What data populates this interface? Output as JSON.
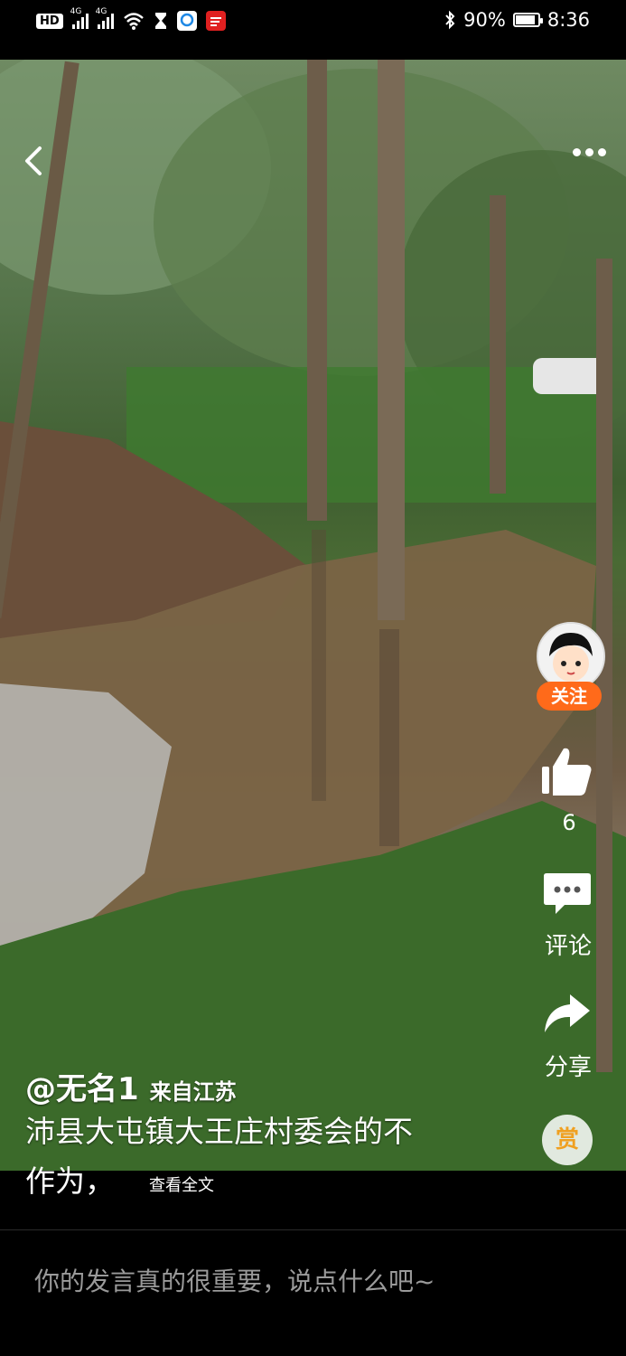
{
  "status_bar": {
    "hd": "HD",
    "signal1": "4G",
    "signal2": "4G",
    "battery": "90%",
    "battery_level": 0.9,
    "time": "8:36"
  },
  "video": {
    "author_handle": "@无名1",
    "location": "来自江苏",
    "caption_line1": "沛县大屯镇大王庄村委会的不",
    "caption_line2": "作为，",
    "see_all": "查看全文"
  },
  "actions": {
    "follow": "关注",
    "like_count": "6",
    "comment": "评论",
    "share": "分享",
    "reward": "赏"
  },
  "comment_bar": {
    "placeholder": "你的发言真的很重要，说点什么吧~"
  },
  "colors": {
    "follow": "#ff6a1a",
    "reward": "#f0a020"
  }
}
